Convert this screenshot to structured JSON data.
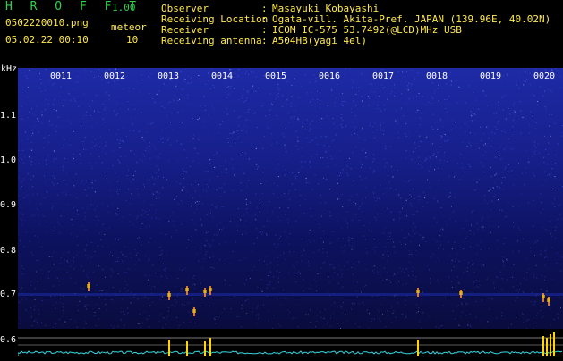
{
  "header": {
    "app_name": "H R O F F T",
    "version": "1.00",
    "file_name": "0502220010.png",
    "datetime": "05.02.22 00:10",
    "meteor_label": "meteor",
    "meteor_count": "10"
  },
  "info": [
    {
      "label": "Observer",
      "value": "Masayuki Kobayashi"
    },
    {
      "label": "Receiving Location",
      "value": "Ogata-vill. Akita-Pref. JAPAN (139.96E, 40.02N)"
    },
    {
      "label": "Receiver",
      "value": "ICOM IC-575 53.7492(@LCD)MHz USB"
    },
    {
      "label": "Receiving antenna",
      "value": "A504HB(yagi 4el)"
    }
  ],
  "y_axis": {
    "unit": "kHz",
    "ticks": [
      "1.1",
      "1.0",
      "0.9",
      "0.8",
      "0.7",
      "0.6"
    ]
  },
  "time_ticks": [
    "0011",
    "0012",
    "0013",
    "0014",
    "0015",
    "0016",
    "0017",
    "0018",
    "0019",
    "0020"
  ],
  "colors": {
    "header_green": "#2fd24a",
    "header_yellow": "#ffe94a",
    "spectrum_high": "#1e2aa6",
    "spectrum_low": "#0a0c3e",
    "meteor_trace": "#ffd400",
    "level_trace": "#33d6e0"
  }
}
